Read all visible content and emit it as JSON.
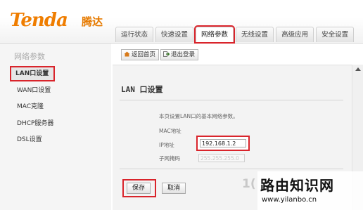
{
  "brand": {
    "logo": "Tenda",
    "logo_cn": "腾达"
  },
  "tabs": [
    {
      "label": "运行状态",
      "active": false
    },
    {
      "label": "快速设置",
      "active": false
    },
    {
      "label": "网络参数",
      "active": true
    },
    {
      "label": "无线设置",
      "active": false
    },
    {
      "label": "高级应用",
      "active": false
    },
    {
      "label": "安全设置",
      "active": false
    }
  ],
  "sidebar": {
    "title": "网络参数",
    "items": [
      {
        "label": "LAN口设置",
        "active": true
      },
      {
        "label": "WAN口设置",
        "active": false
      },
      {
        "label": "MAC克隆",
        "active": false
      },
      {
        "label": "DHCP服务器",
        "active": false
      },
      {
        "label": "DSL设置",
        "active": false
      }
    ]
  },
  "toolbar": {
    "home_label": "返回首页",
    "logout_label": "退出登录",
    "home_icon": "home-icon",
    "logout_icon": "logout-icon"
  },
  "panel": {
    "title": "LAN 口设置",
    "description": "本页设置LAN口的基本网络参数。",
    "mac_label": "MAC地址",
    "ip_label": "IP地址",
    "ip_value": "192.168.1.2",
    "mask_label": "子网掩码",
    "mask_value": "255.255.255.0",
    "save_label": "保存",
    "cancel_label": "取消"
  },
  "watermark": {
    "title": "路由知识网",
    "url": "www.yilanbo.cn",
    "partial": "1("
  },
  "colors": {
    "brand_orange": "#ef7d00",
    "highlight_red": "#d9242b"
  }
}
